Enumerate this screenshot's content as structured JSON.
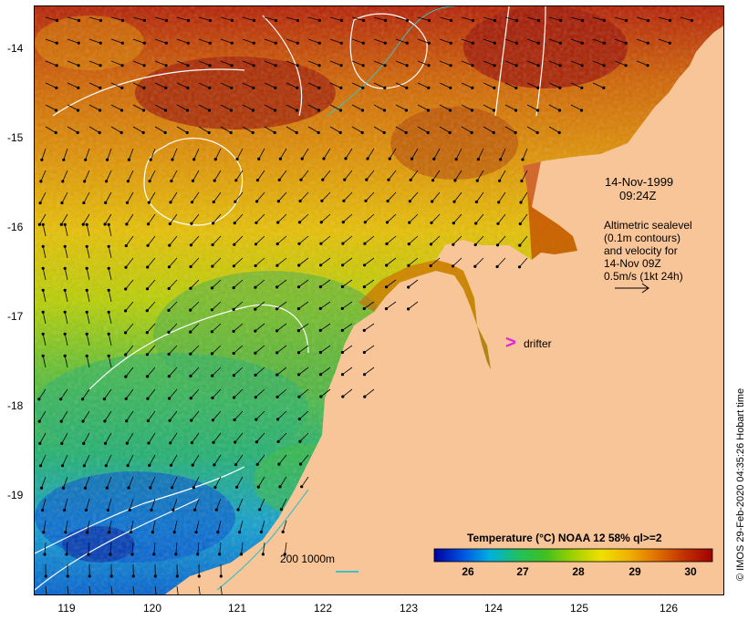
{
  "map": {
    "lat_ticks": [
      "-14",
      "-15",
      "-16",
      "-17",
      "-18",
      "-19"
    ],
    "lon_ticks": [
      "119",
      "120",
      "121",
      "122",
      "123",
      "124",
      "125",
      "126"
    ],
    "lat_range": [
      -20.1,
      -13.6
    ],
    "lon_range": [
      118.65,
      126.7
    ],
    "colors": {
      "land": "#f7c598",
      "contour": "#ffffff",
      "scale_bar": "#40c0c0",
      "drifter": "#e020e0",
      "arrow": "#000000"
    }
  },
  "annotations": {
    "date": "14-Nov-1999",
    "time": "09:24Z",
    "legend_lines": [
      "Altimetric sealevel",
      "(0.1m contours)",
      "and velocity for",
      "14-Nov 09Z",
      "0.5m/s (1kt 24h)"
    ],
    "drifter_symbol": ">",
    "drifter_label": "drifter",
    "scale_bar_label": "200  1000m"
  },
  "colorbar": {
    "title": "Temperature (°C) NOAA 12 58% ql>=2",
    "ticks": [
      "26",
      "27",
      "28",
      "29",
      "30"
    ],
    "range": [
      25.2,
      30.4
    ],
    "stops": [
      "#0000a0",
      "#0050e0",
      "#00b0e0",
      "#20c060",
      "#40c020",
      "#a0d000",
      "#f0e000",
      "#f0b000",
      "#e07000",
      "#c03000",
      "#a00000"
    ]
  },
  "credit": "© IMOS 29-Feb-2020 04:35:26 Hobart time"
}
